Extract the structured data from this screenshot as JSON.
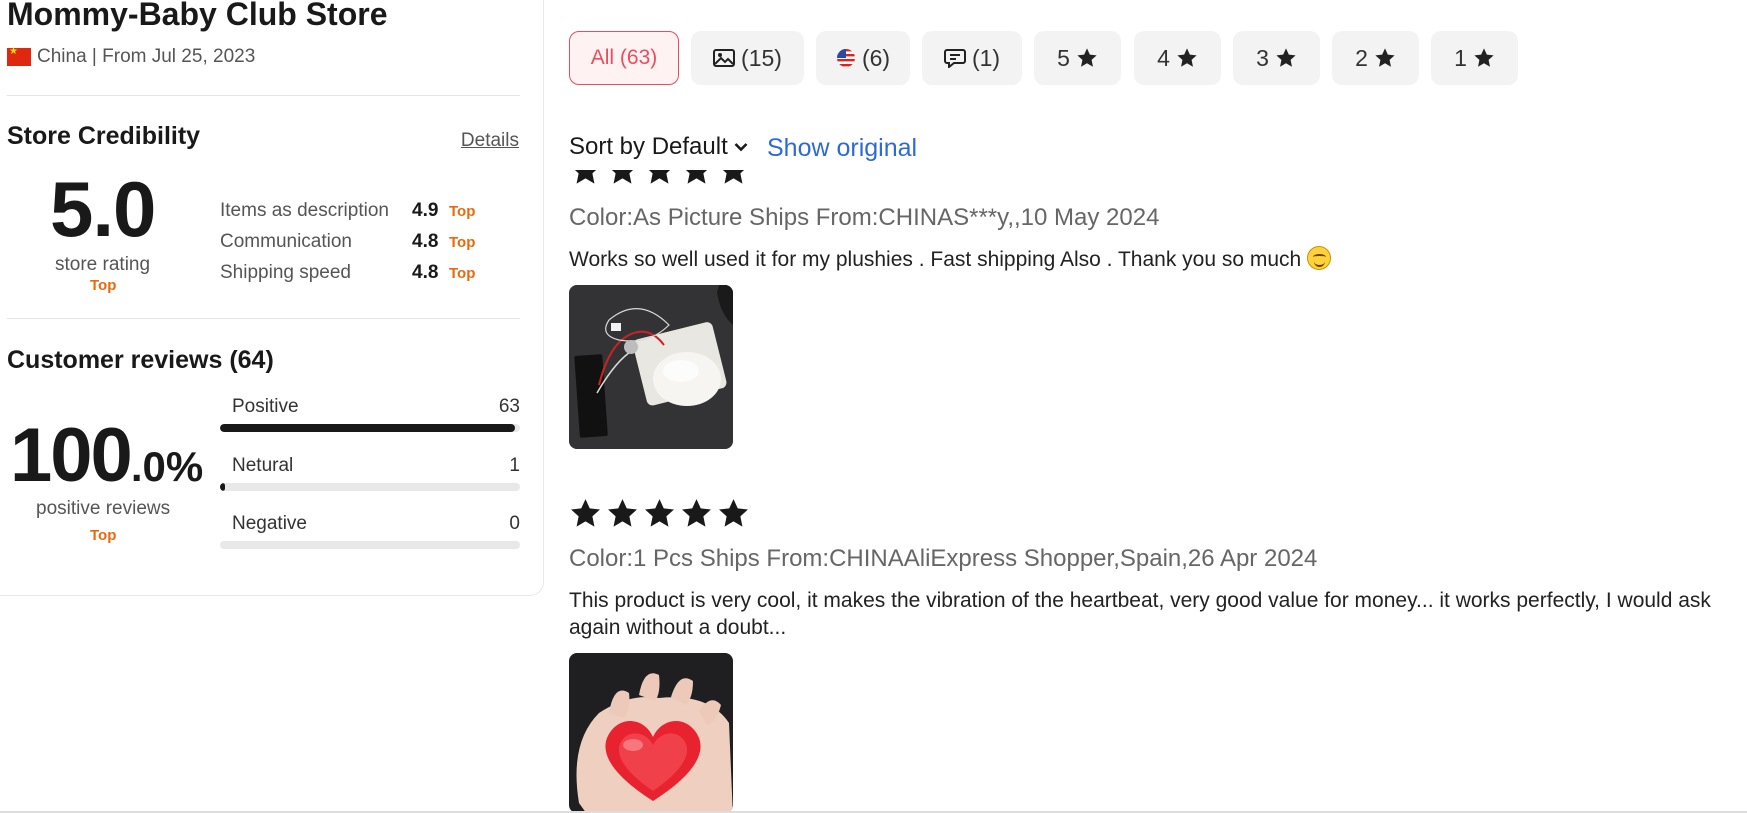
{
  "store": {
    "name": "Mommy-Baby Club Store",
    "origin": "China | From Jul 25, 2023"
  },
  "credibility": {
    "title": "Store Credibility",
    "details_label": "Details",
    "rating": "5.0",
    "rating_caption": "store rating",
    "rating_badge": "Top",
    "metrics": [
      {
        "label": "Items as description",
        "value": "4.9",
        "badge": "Top"
      },
      {
        "label": "Communication",
        "value": "4.8",
        "badge": "Top"
      },
      {
        "label": "Shipping speed",
        "value": "4.8",
        "badge": "Top"
      }
    ]
  },
  "customer_reviews": {
    "title": "Customer reviews (64)",
    "percent_int": "100",
    "percent_dec": ".0%",
    "caption": "positive reviews",
    "badge": "Top",
    "bars": [
      {
        "label": "Positive",
        "count": "63",
        "fraction": 0.984
      },
      {
        "label": "Netural",
        "count": "1",
        "fraction": 0.016
      },
      {
        "label": "Negative",
        "count": "0",
        "fraction": 0
      }
    ]
  },
  "filters": {
    "all": "All (63)",
    "photos": "(15)",
    "local": "(6)",
    "comments": "(1)",
    "star5": "5",
    "star4": "4",
    "star3": "3",
    "star2": "2",
    "star1": "1",
    "icons": [
      "image-icon",
      "us-flag-icon",
      "comment-icon",
      "star-icon"
    ],
    "active_color": "#ea4d5c"
  },
  "sort": {
    "label": "Sort by Default",
    "show_original": "Show original"
  },
  "reviews": [
    {
      "stars": 5,
      "meta": "Color:As Picture Ships From:CHINAS***y,,10 May 2024",
      "text": "Works so well used it for my plushies . Fast shipping Also . Thank you so much"
    },
    {
      "stars": 5,
      "meta": "Color:1 Pcs Ships From:CHINAAliExpress Shopper,Spain,26 Apr 2024",
      "text": "This product is very cool, it makes the vibration of the heartbeat, very good value for money... it works perfectly, I would ask again without a doubt..."
    }
  ]
}
